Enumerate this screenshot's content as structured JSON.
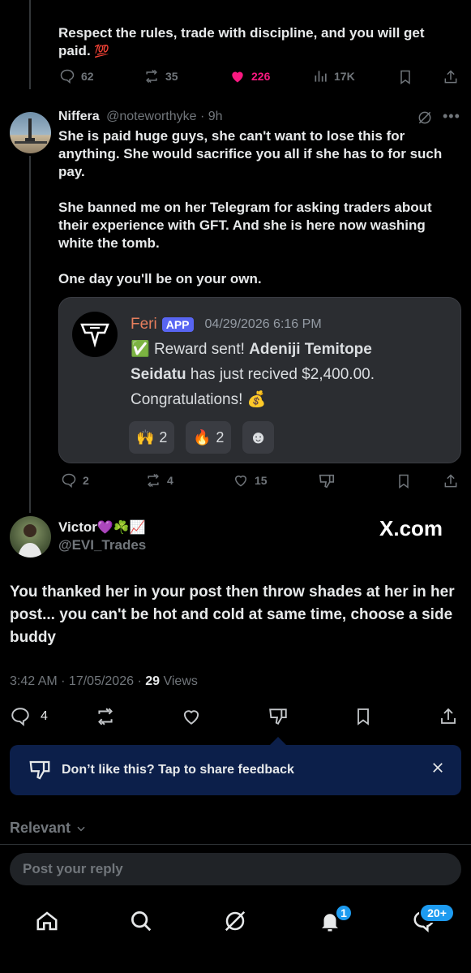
{
  "tweet1": {
    "text_line1": "Respect the rules, trade with discipline, and you will get",
    "text_line2": "paid.",
    "emoji": "💯",
    "replies": "62",
    "reposts": "35",
    "likes": "226",
    "views": "17K"
  },
  "tweet2": {
    "display_name": "Niffera",
    "handle_time": "@noteworthyke · 9h",
    "para1": "She is paid huge guys, she can't want to lose this for anything. She would sacrifice you all if she has to for such pay.",
    "para2": "She banned me on her Telegram for asking traders about their experience with GFT. And she is here now washing white the tomb.",
    "para3": "One day you'll be on your own.",
    "replies": "2",
    "reposts": "4",
    "likes": "15",
    "embed": {
      "author": "Feri",
      "app_tag": "APP",
      "timestamp": "04/29/2026 6:16 PM",
      "check_emoji": "✅",
      "line1_prefix": "Reward sent!",
      "line1_bold": "Adeniji Temitope",
      "line2_bold": "Seidatu",
      "line2_rest": "has just recived $2,400.00.",
      "line3": "Congratulations!",
      "line3_emoji": "💰",
      "reaction1_emoji": "🙌",
      "reaction1_count": "2",
      "reaction2_emoji": "🔥",
      "reaction2_count": "2",
      "add_reaction_emoji": "☻"
    }
  },
  "tweet3": {
    "display_name": "Victor",
    "name_emojis": "💜☘️📈",
    "handle": "@EVI_Trades",
    "watermark": "X.com",
    "text": "You thanked her in your post then throw shades at her in her post... you can't be hot and cold at same time, choose a side buddy",
    "time_date": "3:42 AM · 17/05/2026 ·",
    "views_count": "29",
    "views_label": "Views",
    "replies": "4"
  },
  "feedback_banner": {
    "text": "Don’t like this? Tap to share feedback"
  },
  "sort": {
    "label": "Relevant"
  },
  "reply": {
    "placeholder": "Post your reply"
  },
  "bottom_nav": {
    "notifications_badge": "1",
    "messages_badge": "20+"
  },
  "colors": {
    "background": "#000000",
    "text": "#e7e9ea",
    "muted": "#71767b",
    "like_pink": "#f91880",
    "accent_blue": "#1d9bf0",
    "banner_bg": "#0c1f4a",
    "embed_bg": "#2b2d31",
    "feri_name": "#e67e5d",
    "app_tag": "#5865f2"
  }
}
